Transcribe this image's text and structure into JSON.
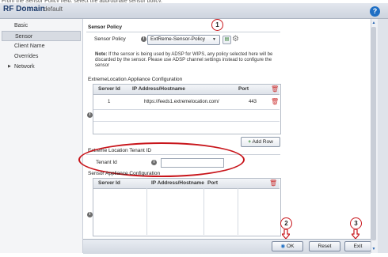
{
  "top_crop_text": "From the Sensor Policy field, select the appropriate sensor policy.",
  "header": {
    "title": "RF Domain",
    "subtitle": "default",
    "help_icon": "?"
  },
  "sidebar": {
    "items": [
      {
        "label": "Basic"
      },
      {
        "label": "Sensor"
      },
      {
        "label": "Client Name"
      },
      {
        "label": "Overrides"
      },
      {
        "label": "Network"
      }
    ],
    "expand_glyph": "▶"
  },
  "sensor_policy": {
    "section_title": "Sensor Policy",
    "field_label": "Sensor Policy",
    "selected_value": "ExtReme-Sensor-Policy",
    "dropdown_arrow": "▼",
    "note_label": "Note:",
    "note_text": "If the sensor is being used by ADSP for WIPS, any policy selected here will be discarded by the sensor. Please use ADSP channel settings instead to configure the sensor"
  },
  "location_appliance": {
    "section_title": "ExtremeLocation Appliance Configuration",
    "columns": [
      "Server Id",
      "IP Address/Hostname",
      "Port"
    ],
    "rows": [
      {
        "server_id": "1",
        "host": "https://feeds1.extremelocation.com/",
        "port": "443"
      }
    ],
    "add_row_label": "Add Row",
    "add_row_icon": "+"
  },
  "tenant": {
    "section_title": "Extreme Location Tenant ID",
    "field_label": "Tenant Id",
    "value": ""
  },
  "sensor_appliance": {
    "section_title": "Sensor Appliance Configuration",
    "columns": [
      "Server Id",
      "IP Address/Hostname",
      "Port"
    ]
  },
  "markers": [
    "1",
    "2",
    "3"
  ],
  "footer": {
    "ok_label": "OK",
    "reset_label": "Reset",
    "exit_label": "Exit"
  },
  "colors": {
    "accent": "#1f6fc4",
    "annotation_red": "#c8151b",
    "add_icon": "#2a8a2a",
    "delete_icon": "#c33333"
  }
}
